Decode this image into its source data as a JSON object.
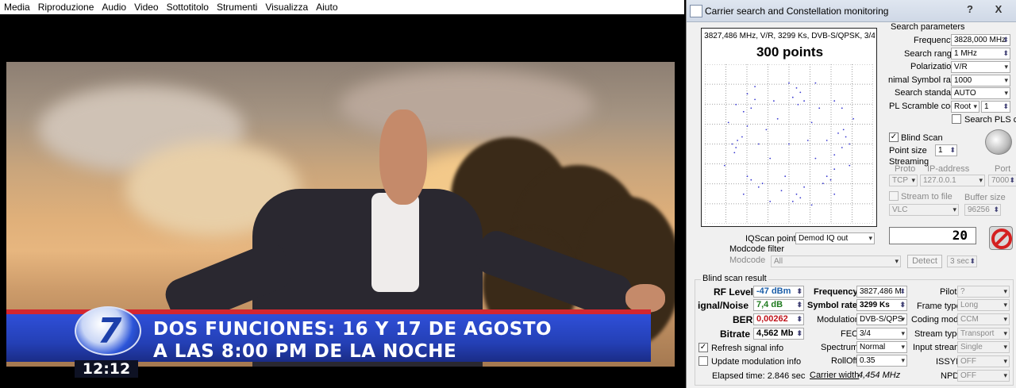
{
  "vlc": {
    "menu": [
      "Media",
      "Riproduzione",
      "Audio",
      "Video",
      "Sottotitolo",
      "Strumenti",
      "Visualizza",
      "Aiuto"
    ],
    "lower_third": {
      "logo_number": "7",
      "line1": "DOS FUNCIONES: 16 Y 17 DE AGOSTO",
      "line2": "A LAS 8:00 PM DE LA NOCHE",
      "clock": "12:12"
    }
  },
  "dialog": {
    "title": "Carrier search and Constellation monitoring",
    "help": "?",
    "close": "X",
    "constellation": {
      "info": "3827,486 MHz, V/R, 3299 Ks, DVB-S/QPSK, 3/4",
      "points": "300 points",
      "iq_points": [
        [
          -0.55,
          0.7
        ],
        [
          -0.5,
          0.5
        ],
        [
          -0.6,
          0.45
        ],
        [
          -0.45,
          0.62
        ],
        [
          0.1,
          0.78
        ],
        [
          0.05,
          0.65
        ],
        [
          0.15,
          0.72
        ],
        [
          0.12,
          0.55
        ],
        [
          0.0,
          0.85
        ],
        [
          0.2,
          0.6
        ],
        [
          -0.7,
          -0.05
        ],
        [
          -0.68,
          0.05
        ],
        [
          -0.75,
          0.0
        ],
        [
          -0.62,
          0.1
        ],
        [
          -0.72,
          -0.12
        ],
        [
          0.75,
          0.1
        ],
        [
          0.72,
          0.2
        ],
        [
          0.8,
          0.0
        ],
        [
          0.65,
          0.15
        ],
        [
          0.7,
          -0.05
        ],
        [
          -0.5,
          -0.5
        ],
        [
          -0.4,
          -0.6
        ],
        [
          -0.55,
          -0.45
        ],
        [
          -0.35,
          -0.55
        ],
        [
          0.5,
          -0.45
        ],
        [
          0.45,
          -0.55
        ],
        [
          0.6,
          -0.35
        ],
        [
          0.55,
          -0.5
        ],
        [
          0.1,
          -0.7
        ],
        [
          0.2,
          -0.6
        ],
        [
          0.05,
          -0.8
        ],
        [
          0.15,
          -0.75
        ],
        [
          -0.1,
          -0.65
        ],
        [
          -0.3,
          0.2
        ],
        [
          0.3,
          0.3
        ],
        [
          -0.15,
          0.35
        ],
        [
          0.4,
          0.5
        ],
        [
          -0.25,
          -0.2
        ],
        [
          0.35,
          -0.2
        ],
        [
          0.0,
          0.0
        ],
        [
          -0.8,
          0.3
        ],
        [
          0.85,
          0.35
        ],
        [
          -0.85,
          -0.3
        ],
        [
          0.8,
          -0.3
        ],
        [
          -0.45,
          0.8
        ],
        [
          0.35,
          0.85
        ],
        [
          -0.2,
          0.6
        ],
        [
          0.6,
          0.6
        ],
        [
          -0.6,
          -0.7
        ],
        [
          0.6,
          -0.7
        ],
        [
          -0.05,
          -0.45
        ],
        [
          0.25,
          0.05
        ],
        [
          -0.4,
          0.0
        ],
        [
          0.5,
          0.05
        ],
        [
          -0.55,
          0.25
        ],
        [
          0.6,
          -0.15
        ],
        [
          -0.25,
          -0.8
        ],
        [
          0.3,
          -0.85
        ],
        [
          -0.7,
          0.55
        ],
        [
          0.7,
          0.5
        ]
      ]
    },
    "search": {
      "group_title": "Search parameters",
      "frequency_label": "Frequency",
      "frequency_value": "3828,000 MHz",
      "range_label": "Search range",
      "range_value": "1 MHz",
      "polarization_label": "Polarization",
      "polarization_value": "V/R",
      "min_sr_label": "nimal Symbol rate",
      "min_sr_value": "1000",
      "standard_label": "Search standard",
      "standard_value": "AUTO",
      "pls_label": "PL Scramble code",
      "pls_mode": "Root",
      "pls_value": "1",
      "search_pls_label": "Search PLS cc"
    },
    "blind": {
      "label": "Blind Scan",
      "point_size_label": "Point size",
      "point_size_value": "1"
    },
    "streaming": {
      "title": "Streaming",
      "proto_label": "Proto",
      "ip_label": "IP-address",
      "port_label": "Port",
      "proto_value": "TCP",
      "ip_value": "127.0.0.1",
      "port_value": "7000",
      "stream_file_label": "Stream to file",
      "buffer_label": "Buffer size",
      "player_value": "VLC",
      "buffer_value": "96256"
    },
    "iqscan": {
      "label": "IQScan point",
      "value": "Demod IQ out",
      "counter": "20"
    },
    "modcode": {
      "title": "Modcode filter",
      "label": "Modcode",
      "value": "All",
      "detect": "Detect",
      "secs": "3 sec"
    },
    "result": {
      "title": "Blind scan result",
      "rf_label": "RF Level",
      "rf_value": "-47 dBm",
      "snr_label": "ignal/Noise",
      "snr_value": "7,4 dB",
      "ber_label": "BER",
      "ber_value": "0,00262",
      "bitrate_label": "Bitrate",
      "bitrate_value": "4,562 Mb",
      "freq_label": "Frequency",
      "freq_value": "3827,486 M",
      "sr_label": "Symbol rate",
      "sr_value": "3299 Ks",
      "mod_label": "Modulation",
      "mod_value": "DVB-S/QPS",
      "fec_label": "FEC",
      "fec_value": "3/4",
      "spectrum_label": "Spectrum",
      "spectrum_value": "Normal",
      "rolloff_label": "RollOff",
      "rolloff_value": "0.35",
      "carrier_label": "Carrier width",
      "carrier_value": "4,454 MHz",
      "pilot_label": "Pilot",
      "pilot_value": "?",
      "frame_label": "Frame type",
      "frame_value": "Long",
      "coding_label": "Coding mode",
      "coding_value": "CCM",
      "stream_label": "Stream type",
      "stream_value": "Transport",
      "input_label": "Input stream",
      "input_value": "Single",
      "issyi_label": "ISSYI",
      "issyi_value": "OFF",
      "npd_label": "NPD",
      "npd_value": "OFF",
      "refresh_label": "Refresh signal info",
      "update_label": "Update modulation info",
      "elapsed": "Elapsed time: 2.846 sec"
    },
    "colors": {
      "rf": "#1b5ea8",
      "snr": "#1d7a1d",
      "ber": "#c0141c",
      "stop": "#d42020"
    }
  }
}
